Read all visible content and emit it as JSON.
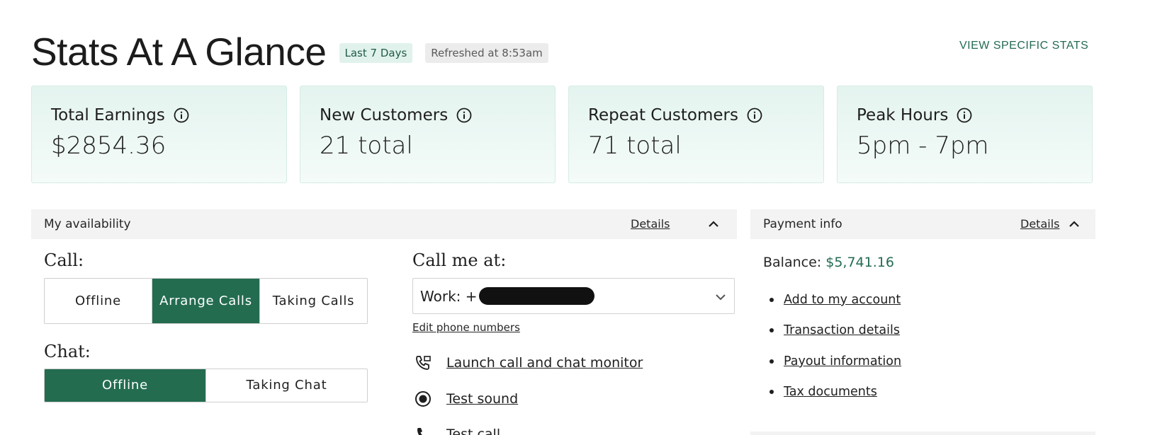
{
  "header": {
    "title": "Stats At A Glance",
    "range_badge": "Last 7 Days",
    "refresh_badge": "Refreshed at 8:53am",
    "view_specific_stats": "VIEW SPECIFIC STATS"
  },
  "stats": [
    {
      "title": "Total Earnings",
      "value": "$2854.36",
      "icon": "info-icon"
    },
    {
      "title": "New Customers",
      "value": "21 total",
      "icon": "info-icon"
    },
    {
      "title": "Repeat Customers",
      "value": "71 total",
      "icon": "info-icon"
    },
    {
      "title": "Peak Hours",
      "value": "5pm - 7pm",
      "icon": "info-icon"
    }
  ],
  "availability": {
    "title": "My availability",
    "details_label": "Details",
    "call_label": "Call:",
    "call_options": [
      "Offline",
      "Arrange Calls",
      "Taking Calls"
    ],
    "call_selected": "Arrange Calls",
    "chat_label": "Chat:",
    "chat_options": [
      "Offline",
      "Taking Chat"
    ],
    "chat_selected": "Offline",
    "call_me_at_label": "Call me at:",
    "phone_value_prefix": "Work: +",
    "edit_phone_numbers": "Edit phone numbers",
    "actions": [
      {
        "label": "Launch call and chat monitor",
        "icon": "phone-monitor-icon"
      },
      {
        "label": "Test sound",
        "icon": "radio-target-icon"
      },
      {
        "label": "Test call",
        "icon": "phone-icon"
      }
    ]
  },
  "payment": {
    "title": "Payment info",
    "details_label": "Details",
    "balance_label": "Balance:",
    "balance_value": "$5,741.16",
    "links": [
      "Add to my account",
      "Transaction details",
      "Payout information",
      "Tax documents"
    ]
  },
  "colors": {
    "accent": "#236c50",
    "badge_green_bg": "#e1f2ec",
    "card_bg": "#e4f4ef",
    "panel_header_bg": "#f3f3f3"
  }
}
